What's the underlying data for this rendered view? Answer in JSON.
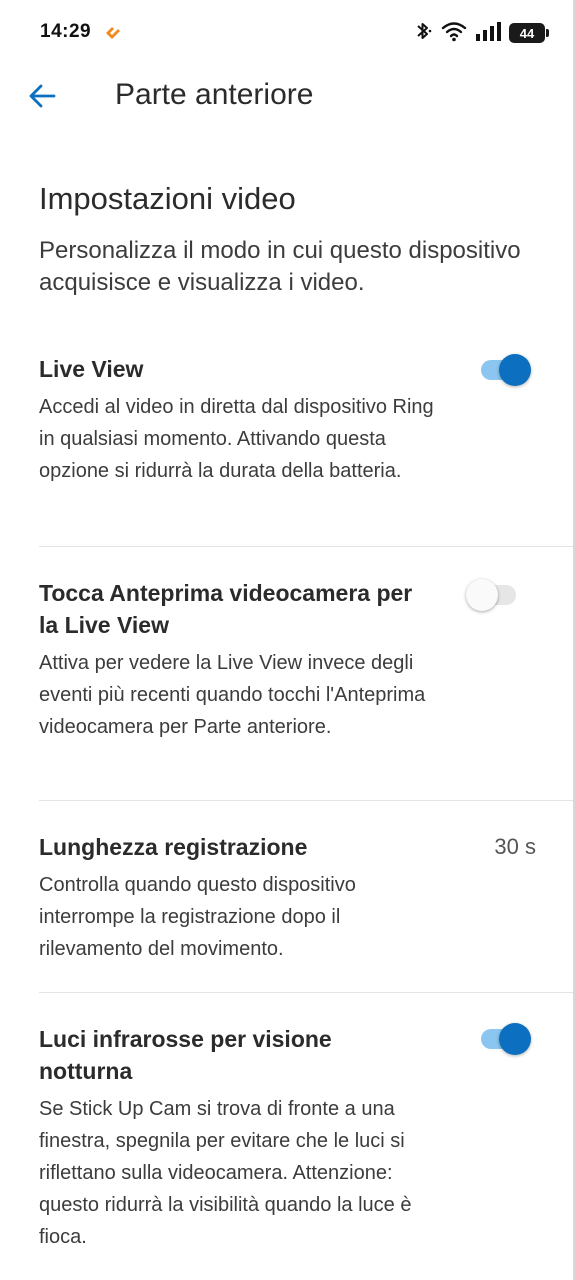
{
  "status_bar": {
    "time": "14:29",
    "app_icon": "ring-logo-icon",
    "battery": "44",
    "icons": [
      "bluetooth-icon",
      "wifi-icon",
      "signal-icon",
      "battery-icon"
    ]
  },
  "header": {
    "back_icon": "arrow-left-icon",
    "title": "Parte anteriore"
  },
  "section": {
    "title": "Impostazioni video",
    "description": "Personalizza il modo in cui questo dispositivo acquisisce e visualizza i video."
  },
  "settings": [
    {
      "title": "Live View",
      "description": "Accedi al video in diretta dal dispositivo Ring in qualsiasi momento. Attivando questa opzione si ridurrà la durata della batteria.",
      "toggle": "on"
    },
    {
      "title": "Tocca Anteprima videocamera per la Live View",
      "description": "Attiva per vedere la Live View invece degli eventi più recenti quando tocchi l'Anteprima videocamera per Parte anteriore.",
      "toggle": "off"
    },
    {
      "title": "Lunghezza registrazione",
      "value": "30 s",
      "description": "Controlla quando questo dispositivo interrompe la registrazione dopo il rilevamento del movimento."
    },
    {
      "title": "Luci infrarosse per visione notturna",
      "description": "Se Stick Up Cam si trova di fronte a una finestra, spegnila per evitare che le luci si riflettano sulla videocamera. Attenzione: questo ridurrà la visibilità quando la luce è fioca.",
      "toggle": "on"
    }
  ],
  "colors": {
    "accent": "#0c6fbf",
    "toggle_track_on": "#8ac6ef",
    "text": "#2b2b2b"
  }
}
